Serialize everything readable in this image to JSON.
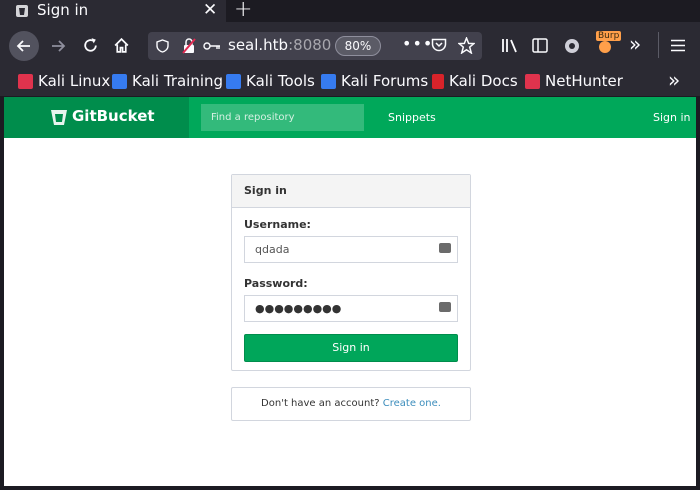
{
  "browser": {
    "tab": {
      "title": "Sign in"
    },
    "url": {
      "host": "seal.htb",
      "port": ":8080",
      "zoom": "80%"
    },
    "burp_label": "Burp",
    "bookmarks": [
      {
        "label": "Kali Linux",
        "icon": "kali-linux-icon",
        "color": "#e0334d"
      },
      {
        "label": "Kali Training",
        "icon": "kali-training-icon",
        "color": "#367bf0"
      },
      {
        "label": "Kali Tools",
        "icon": "kali-tools-icon",
        "color": "#367bf0"
      },
      {
        "label": "Kali Forums",
        "icon": "kali-forums-icon",
        "color": "#367bf0"
      },
      {
        "label": "Kali Docs",
        "icon": "kali-docs-icon",
        "color": "#d8232a"
      },
      {
        "label": "NetHunter",
        "icon": "nethunter-icon",
        "color": "#e0334d"
      }
    ]
  },
  "gitbucket": {
    "brand": "GitBucket",
    "search_placeholder": "Find a repository",
    "nav_snippets": "Snippets",
    "nav_signin": "Sign in",
    "colors": {
      "header": "#00a85a",
      "brand_bg": "#008d4c",
      "link": "#3c8dbc"
    }
  },
  "login": {
    "heading": "Sign in",
    "username_label": "Username:",
    "username_value": "qdada",
    "password_label": "Password:",
    "password_value": "●●●●●●●●●",
    "submit_label": "Sign in",
    "no_account_text": "Don't have an account?",
    "create_link": "Create one."
  }
}
